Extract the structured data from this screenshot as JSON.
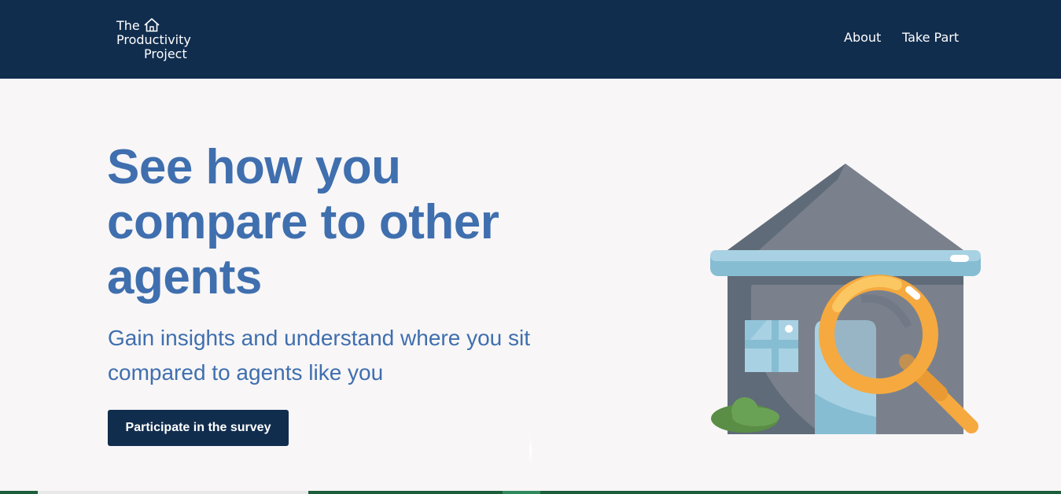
{
  "header": {
    "logo": {
      "line1": "The",
      "line2": "Productivity",
      "line3": "Project",
      "icon": "house-icon"
    },
    "nav": [
      {
        "label": "About"
      },
      {
        "label": "Take Part"
      }
    ]
  },
  "hero": {
    "title": "See how you compare to other agents",
    "subtitle": "Gain insights and understand where you sit compared to agents like you",
    "cta_label": "Participate in the survey",
    "illustration": "house-magnifying-glass-illustration"
  },
  "colors": {
    "navy": "#112d4e",
    "headline_blue": "#3f6fae",
    "background": "#f8f6f7",
    "magnifier_orange": "#f5b642"
  }
}
